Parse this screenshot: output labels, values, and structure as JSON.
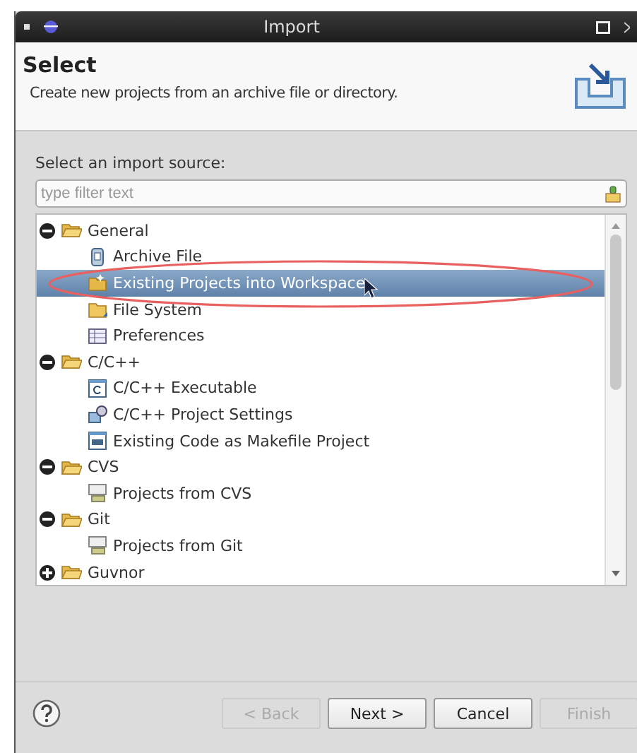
{
  "window": {
    "title": "Import"
  },
  "header": {
    "title": "Select",
    "description": "Create new projects from an archive file or directory."
  },
  "source_label": "Select an import source:",
  "filter": {
    "placeholder": "type filter text"
  },
  "tree": [
    {
      "label": "General",
      "expanded": true,
      "selected": false,
      "children": [
        {
          "label": "Archive File",
          "kind": "archive",
          "selected": false
        },
        {
          "label": "Existing Projects into Workspace",
          "kind": "project",
          "selected": true
        },
        {
          "label": "File System",
          "kind": "folder",
          "selected": false
        },
        {
          "label": "Preferences",
          "kind": "table",
          "selected": false
        }
      ]
    },
    {
      "label": "C/C++",
      "expanded": true,
      "selected": false,
      "children": [
        {
          "label": "C/C++ Executable",
          "kind": "exe",
          "selected": false
        },
        {
          "label": "C/C++ Project Settings",
          "kind": "settings",
          "selected": false
        },
        {
          "label": "Existing Code as Makefile Project",
          "kind": "makefile",
          "selected": false
        }
      ]
    },
    {
      "label": "CVS",
      "expanded": true,
      "selected": false,
      "children": [
        {
          "label": "Projects from CVS",
          "kind": "repo",
          "selected": false
        }
      ]
    },
    {
      "label": "Git",
      "expanded": true,
      "selected": false,
      "children": [
        {
          "label": "Projects from Git",
          "kind": "repo",
          "selected": false
        }
      ]
    },
    {
      "label": "Guvnor",
      "expanded": false,
      "selected": false
    }
  ],
  "buttons": [
    {
      "label": "< Back",
      "disabled": true
    },
    {
      "label": "Next >",
      "disabled": false
    },
    {
      "label": "Cancel",
      "disabled": false
    },
    {
      "label": "Finish",
      "disabled": true
    }
  ]
}
